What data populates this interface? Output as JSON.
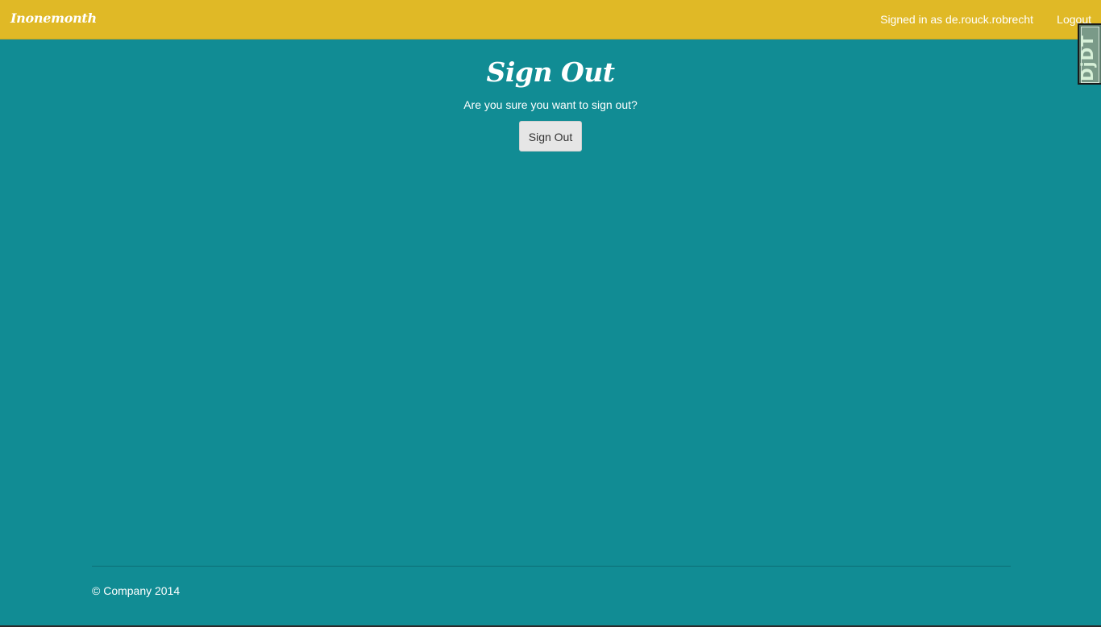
{
  "navbar": {
    "brand": "Inonemonth",
    "signed_in_text": "Signed in as de.rouck.robrecht",
    "logout_label": "Logout",
    "background_color": "#e0b926"
  },
  "debug_toolbar": {
    "label": "DjDT"
  },
  "main": {
    "title": "Sign Out",
    "confirm_text": "Are you sure you want to sign out?",
    "sign_out_button_label": "Sign Out",
    "background_color": "#118c94"
  },
  "footer": {
    "copyright": "© Company 2014"
  }
}
